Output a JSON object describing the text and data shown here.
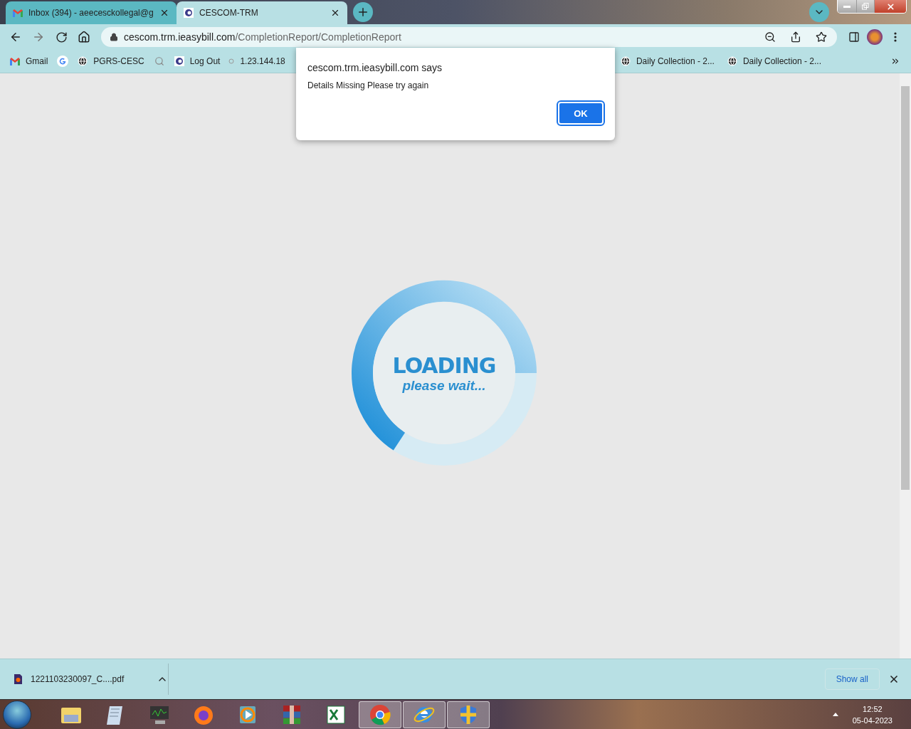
{
  "browser_tabs": [
    {
      "title": "Inbox (394) - aeecesckollegal@g",
      "kind": "gmail",
      "selected": false
    },
    {
      "title": "CESCOM-TRM",
      "kind": "site",
      "selected": true
    }
  ],
  "address_bar": {
    "host": "cescom.trm.ieasybill.com",
    "path": "/CompletionReport/CompletionReport"
  },
  "bookmarks_left": [
    {
      "kind": "gmail",
      "label": "Gmail"
    },
    {
      "kind": "google"
    },
    {
      "kind": "globe",
      "label": "PGRS-CESC"
    },
    {
      "kind": "search"
    },
    {
      "kind": "site",
      "label": "Log Out"
    },
    {
      "kind": "dot",
      "label": "1.23.144.18"
    }
  ],
  "bookmarks_right": [
    {
      "kind": "globe",
      "label": "Daily Collection - 2..."
    },
    {
      "kind": "globe",
      "label": "Daily Collection - 2..."
    }
  ],
  "dialog": {
    "title": "cescom.trm.ieasybill.com says",
    "message": "Details Missing Please try again",
    "button": "OK"
  },
  "loader": {
    "title": "LOADING",
    "subtitle": "please wait..."
  },
  "download_bar": {
    "file": "1221103230097_C....pdf",
    "show_all": "Show all"
  },
  "taskbar": {
    "apps": [
      {
        "kind": "explorer",
        "open": false
      },
      {
        "kind": "notepad",
        "open": false
      },
      {
        "kind": "monitor",
        "open": false
      },
      {
        "kind": "firefox",
        "open": false
      },
      {
        "kind": "media",
        "open": false
      },
      {
        "kind": "archive",
        "open": false
      },
      {
        "kind": "excel",
        "open": false
      },
      {
        "kind": "chrome",
        "open": true
      },
      {
        "kind": "ie",
        "open": true
      },
      {
        "kind": "shield",
        "open": true
      }
    ],
    "time": "12:52",
    "date": "05-04-2023"
  }
}
